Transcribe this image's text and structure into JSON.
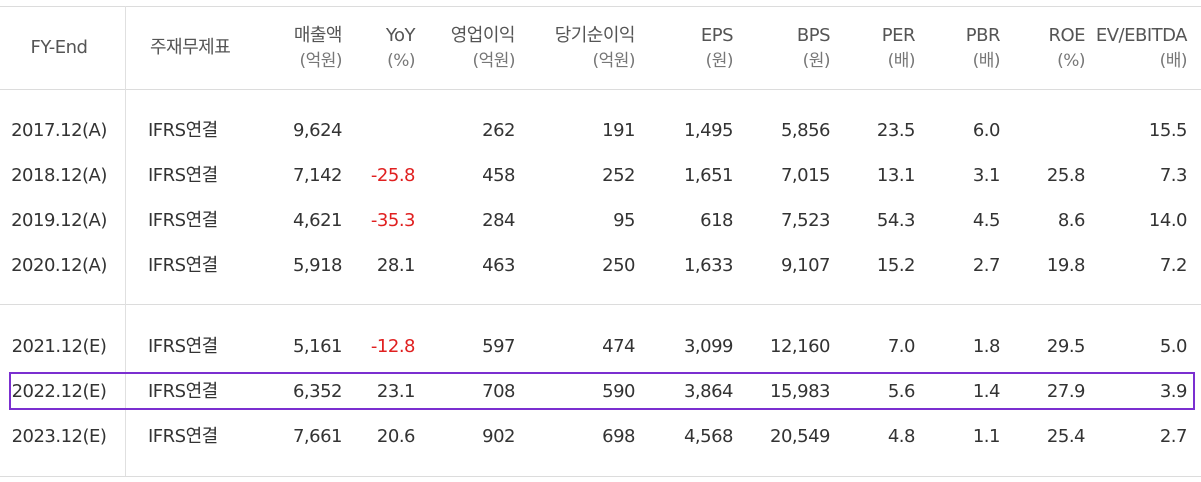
{
  "headers": [
    {
      "label": "FY-End",
      "unit": ""
    },
    {
      "label": "주재무제표",
      "unit": ""
    },
    {
      "label": "매출액",
      "unit": "(억원)"
    },
    {
      "label": "YoY",
      "unit": "(%)"
    },
    {
      "label": "영업이익",
      "unit": "(억원)"
    },
    {
      "label": "당기순이익",
      "unit": "(억원)"
    },
    {
      "label": "EPS",
      "unit": "(원)"
    },
    {
      "label": "BPS",
      "unit": "(원)"
    },
    {
      "label": "PER",
      "unit": "(배)"
    },
    {
      "label": "PBR",
      "unit": "(배)"
    },
    {
      "label": "ROE",
      "unit": "(%)"
    },
    {
      "label": "EV/EBITDA",
      "unit": "(배)"
    }
  ],
  "rows": [
    {
      "fy": "2017.12(A)",
      "basis": "IFRS연결",
      "sales": "9,624",
      "yoy": "",
      "op": "262",
      "net": "191",
      "eps": "1,495",
      "bps": "5,856",
      "per": "23.5",
      "pbr": "6.0",
      "roe": "",
      "ev": "15.5"
    },
    {
      "fy": "2018.12(A)",
      "basis": "IFRS연결",
      "sales": "7,142",
      "yoy": "-25.8",
      "op": "458",
      "net": "252",
      "eps": "1,651",
      "bps": "7,015",
      "per": "13.1",
      "pbr": "3.1",
      "roe": "25.8",
      "ev": "7.3"
    },
    {
      "fy": "2019.12(A)",
      "basis": "IFRS연결",
      "sales": "4,621",
      "yoy": "-35.3",
      "op": "284",
      "net": "95",
      "eps": "618",
      "bps": "7,523",
      "per": "54.3",
      "pbr": "4.5",
      "roe": "8.6",
      "ev": "14.0"
    },
    {
      "fy": "2020.12(A)",
      "basis": "IFRS연결",
      "sales": "5,918",
      "yoy": "28.1",
      "op": "463",
      "net": "250",
      "eps": "1,633",
      "bps": "9,107",
      "per": "15.2",
      "pbr": "2.7",
      "roe": "19.8",
      "ev": "7.2"
    },
    {
      "fy": "2021.12(E)",
      "basis": "IFRS연결",
      "sales": "5,161",
      "yoy": "-12.8",
      "op": "597",
      "net": "474",
      "eps": "3,099",
      "bps": "12,160",
      "per": "7.0",
      "pbr": "1.8",
      "roe": "29.5",
      "ev": "5.0"
    },
    {
      "fy": "2022.12(E)",
      "basis": "IFRS연결",
      "sales": "6,352",
      "yoy": "23.1",
      "op": "708",
      "net": "590",
      "eps": "3,864",
      "bps": "15,983",
      "per": "5.6",
      "pbr": "1.4",
      "roe": "27.9",
      "ev": "3.9"
    },
    {
      "fy": "2023.12(E)",
      "basis": "IFRS연결",
      "sales": "7,661",
      "yoy": "20.6",
      "op": "902",
      "net": "698",
      "eps": "4,568",
      "bps": "20,549",
      "per": "4.8",
      "pbr": "1.1",
      "roe": "25.4",
      "ev": "2.7"
    }
  ],
  "colors": {
    "negative": "#e02020",
    "highlight_border": "#7b2fd0",
    "text": "#333333"
  },
  "highlighted_row": "2022.12(E)"
}
